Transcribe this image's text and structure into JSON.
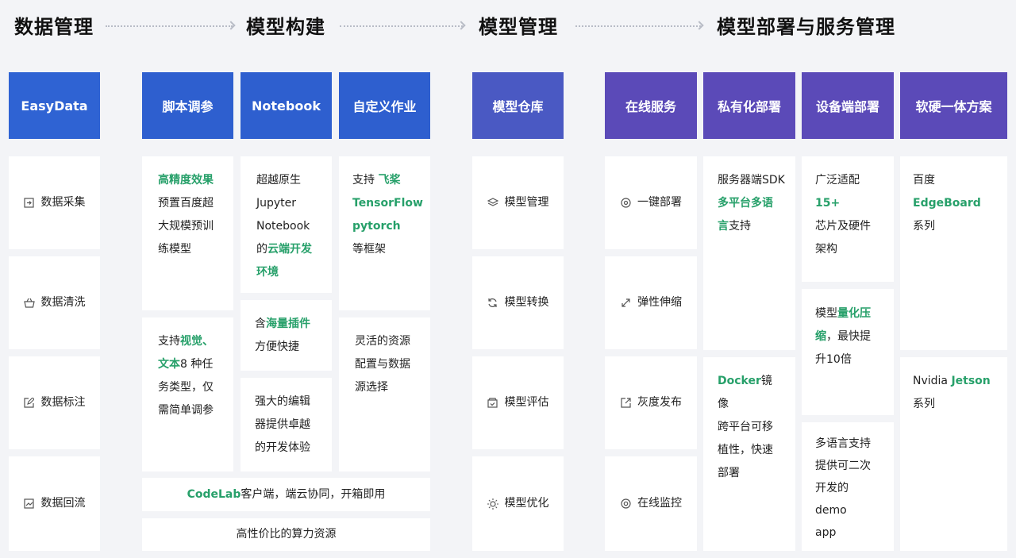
{
  "stages": [
    "数据管理",
    "模型构建",
    "模型管理",
    "模型部署与服务管理"
  ],
  "headers": {
    "easydata": "EasyData",
    "script": "脚本调参",
    "notebook": "Notebook",
    "custom": "自定义作业",
    "repo": "模型仓库",
    "online": "在线服务",
    "private": "私有化部署",
    "device": "设备端部署",
    "hw": "软硬一体方案"
  },
  "data_items": [
    "数据采集",
    "数据清洗",
    "数据标注",
    "数据回流"
  ],
  "model_items": [
    "模型管理",
    "模型转换",
    "模型评估",
    "模型优化"
  ],
  "service_items": [
    "一键部署",
    "弹性伸缩",
    "灰度发布",
    "在线监控"
  ],
  "script1": {
    "g1": "高精度效果",
    "l2": "预置百度超",
    "l3": "大规模预训",
    "l4": "练模型"
  },
  "script2": {
    "t1": "支持",
    "g1": "视觉、",
    "g2": "文本",
    "t2": "8 种任",
    "l3": "务类型，仅",
    "l4": "需简单调参"
  },
  "nb1": {
    "l1": "超越原生",
    "l2": "Jupyter",
    "l3": "Notebook",
    "t4": "的",
    "g4": "云端开发",
    "g5": "环境"
  },
  "nb2": {
    "t1": "含",
    "g1": "海量插件",
    "l2": "方便快捷"
  },
  "nb3": {
    "l1": "强大的编辑",
    "l2": "器提供卓越",
    "l3": "的开发体验"
  },
  "cj1": {
    "t1": "支持 ",
    "g1": "飞桨",
    "g2": "TensorFlow",
    "g3": "pytorch",
    "l4": "等框架"
  },
  "cj2": {
    "l1": "灵活的资源",
    "l2": "配置与数据",
    "l3": "源选择"
  },
  "codelab": {
    "g": "CodeLab",
    "t": "客户端，端云协同，开箱即用"
  },
  "compute": "高性价比的算力资源",
  "pv1": {
    "l1": "服务器端SDK",
    "g2": "多平台多语",
    "g3": "言",
    "t3": "支持"
  },
  "pv2": {
    "g1": "Docker",
    "t1": "镜像",
    "l2": "跨平台可移",
    "l3": "植性，快速",
    "l4": "部署"
  },
  "dv1": {
    "t1": "广泛适配",
    "g1": "15+",
    "l2": "芯片及硬件",
    "l3": "架构"
  },
  "dv2": {
    "t1": "模型",
    "g1": "量化压",
    "g2": "缩",
    "t2": "，最快提",
    "l3": "升10倍"
  },
  "dv3": {
    "l1": "多语言支持",
    "l2": "提供可二次",
    "l3": "开发的demo",
    "l4": "app"
  },
  "hw1": {
    "t1": "百度",
    "g1": "EdgeBoard",
    "l2": "系列"
  },
  "hw2": {
    "t1": "Nvidia ",
    "g1": "Jetson",
    "l2": "系列"
  },
  "colors": {
    "accent_green": "#27a06a",
    "blue": "#2f63d3",
    "indigo": "#4a59c3",
    "violet": "#5b4ab8"
  }
}
